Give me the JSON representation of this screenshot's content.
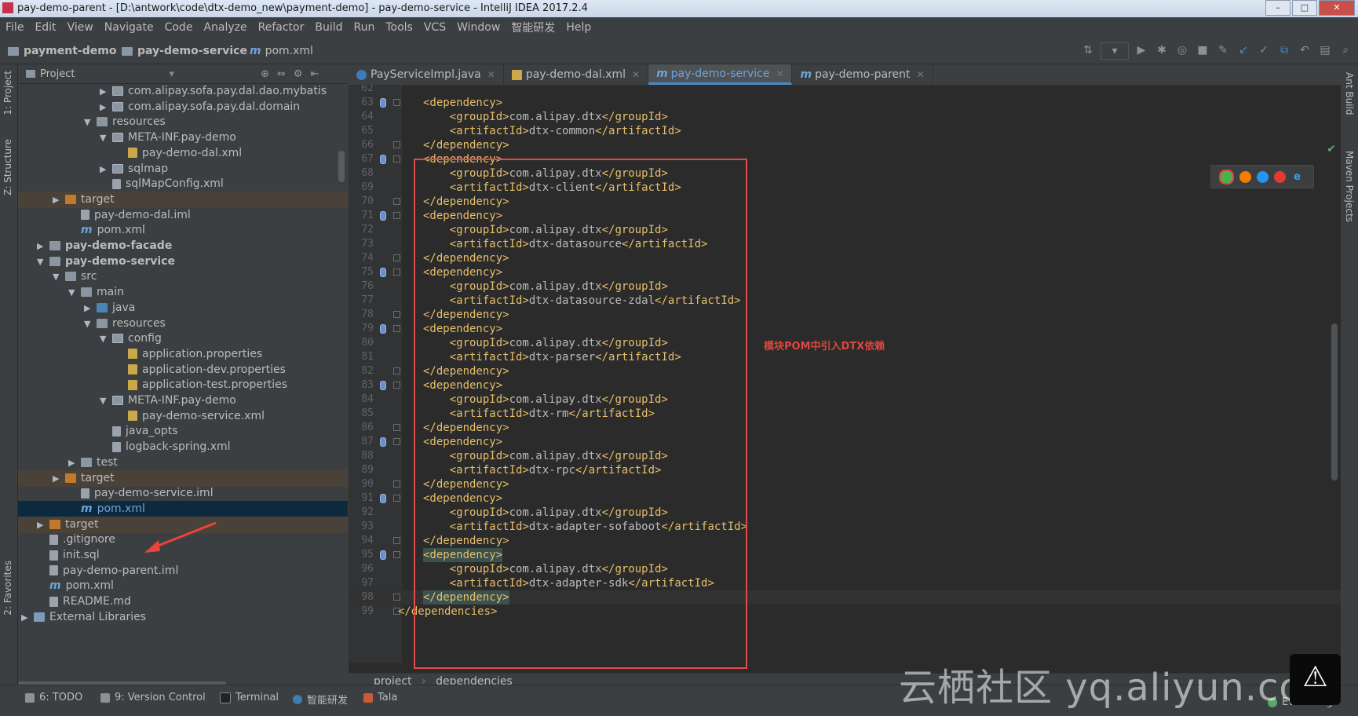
{
  "window": {
    "title": "pay-demo-parent - [D:\\antwork\\code\\dtx-demo_new\\payment-demo] - pay-demo-service - IntelliJ IDEA 2017.2.4"
  },
  "menu": [
    "File",
    "Edit",
    "View",
    "Navigate",
    "Code",
    "Analyze",
    "Refactor",
    "Build",
    "Run",
    "Tools",
    "VCS",
    "Window",
    "智能研发",
    "Help"
  ],
  "breadcrumbs": {
    "root": "payment-demo",
    "module": "pay-demo-service",
    "file": "pom.xml"
  },
  "left_tools": {
    "project": "1: Project",
    "structure": "Z: Structure",
    "favorites": "2: Favorites"
  },
  "right_tools": {
    "ant": "Ant Build",
    "maven": "Maven Projects"
  },
  "project_panel": {
    "header": "Project",
    "tree": [
      {
        "label": "com.alipay.sofa.pay.dal.dao.mybatis",
        "icon": "package-icon",
        "arrow": "▶"
      },
      {
        "label": "com.alipay.sofa.pay.dal.domain",
        "icon": "package-icon",
        "arrow": "▶"
      },
      {
        "label": "resources",
        "icon": "folder-icon",
        "arrow": "▼"
      },
      {
        "label": "META-INF.pay-demo",
        "icon": "package-icon",
        "arrow": "▼"
      },
      {
        "label": "pay-demo-dal.xml",
        "icon": "xml-file-icon",
        "arrow": ""
      },
      {
        "label": "sqlmap",
        "icon": "package-icon",
        "arrow": "▶"
      },
      {
        "label": "sqlMapConfig.xml",
        "icon": "file-icon",
        "arrow": ""
      },
      {
        "label": "target",
        "icon": "folder-orange-icon",
        "arrow": "▶"
      },
      {
        "label": "pay-demo-dal.iml",
        "icon": "file-icon",
        "arrow": ""
      },
      {
        "label": "pom.xml",
        "icon": "maven-icon",
        "arrow": ""
      },
      {
        "label": "pay-demo-facade",
        "icon": "module-icon",
        "arrow": "▶"
      },
      {
        "label": "pay-demo-service",
        "icon": "module-icon",
        "arrow": "▼"
      },
      {
        "label": "src",
        "icon": "folder-icon",
        "arrow": "▼"
      },
      {
        "label": "main",
        "icon": "folder-icon",
        "arrow": "▼"
      },
      {
        "label": "java",
        "icon": "source-folder-icon",
        "arrow": "▶"
      },
      {
        "label": "resources",
        "icon": "folder-icon",
        "arrow": "▼"
      },
      {
        "label": "config",
        "icon": "package-icon",
        "arrow": "▼"
      },
      {
        "label": "application.properties",
        "icon": "properties-file-icon",
        "arrow": ""
      },
      {
        "label": "application-dev.properties",
        "icon": "properties-file-icon",
        "arrow": ""
      },
      {
        "label": "application-test.properties",
        "icon": "properties-file-icon",
        "arrow": ""
      },
      {
        "label": "META-INF.pay-demo",
        "icon": "package-icon",
        "arrow": "▼"
      },
      {
        "label": "pay-demo-service.xml",
        "icon": "xml-file-icon",
        "arrow": ""
      },
      {
        "label": "java_opts",
        "icon": "file-icon",
        "arrow": ""
      },
      {
        "label": "logback-spring.xml",
        "icon": "file-icon",
        "arrow": ""
      },
      {
        "label": "test",
        "icon": "folder-icon",
        "arrow": "▶"
      },
      {
        "label": "target",
        "icon": "folder-orange-icon",
        "arrow": "▶"
      },
      {
        "label": "pay-demo-service.iml",
        "icon": "file-icon",
        "arrow": ""
      },
      {
        "label": "pom.xml",
        "icon": "maven-icon",
        "arrow": ""
      },
      {
        "label": "target",
        "icon": "folder-orange-icon",
        "arrow": "▶"
      },
      {
        "label": ".gitignore",
        "icon": "file-icon",
        "arrow": ""
      },
      {
        "label": "init.sql",
        "icon": "file-icon",
        "arrow": ""
      },
      {
        "label": "pay-demo-parent.iml",
        "icon": "file-icon",
        "arrow": ""
      },
      {
        "label": "pom.xml",
        "icon": "maven-icon",
        "arrow": ""
      },
      {
        "label": "README.md",
        "icon": "file-icon",
        "arrow": ""
      },
      {
        "label": "External Libraries",
        "icon": "libraries-icon",
        "arrow": "▶"
      }
    ]
  },
  "editor": {
    "tabs": [
      {
        "label": "PayServiceImpl.java",
        "active": false
      },
      {
        "label": "pay-demo-dal.xml",
        "active": false
      },
      {
        "label": "pay-demo-service",
        "active": true
      },
      {
        "label": "pay-demo-parent",
        "active": false
      }
    ],
    "lines": [
      {
        "n": "62",
        "text": ""
      },
      {
        "n": "63",
        "text": "<dependency>"
      },
      {
        "n": "64",
        "text": "    <groupId>com.alipay.dtx</groupId>"
      },
      {
        "n": "65",
        "text": "    <artifactId>dtx-common</artifactId>"
      },
      {
        "n": "66",
        "text": "</dependency>"
      },
      {
        "n": "67",
        "text": "<dependency>"
      },
      {
        "n": "68",
        "text": "    <groupId>com.alipay.dtx</groupId>"
      },
      {
        "n": "69",
        "text": "    <artifactId>dtx-client</artifactId>"
      },
      {
        "n": "70",
        "text": "</dependency>"
      },
      {
        "n": "71",
        "text": "<dependency>"
      },
      {
        "n": "72",
        "text": "    <groupId>com.alipay.dtx</groupId>"
      },
      {
        "n": "73",
        "text": "    <artifactId>dtx-datasource</artifactId>"
      },
      {
        "n": "74",
        "text": "</dependency>"
      },
      {
        "n": "75",
        "text": "<dependency>"
      },
      {
        "n": "76",
        "text": "    <groupId>com.alipay.dtx</groupId>"
      },
      {
        "n": "77",
        "text": "    <artifactId>dtx-datasource-zdal</artifactId>"
      },
      {
        "n": "78",
        "text": "</dependency>"
      },
      {
        "n": "79",
        "text": "<dependency>"
      },
      {
        "n": "80",
        "text": "    <groupId>com.alipay.dtx</groupId>"
      },
      {
        "n": "81",
        "text": "    <artifactId>dtx-parser</artifactId>"
      },
      {
        "n": "82",
        "text": "</dependency>"
      },
      {
        "n": "83",
        "text": "<dependency>"
      },
      {
        "n": "84",
        "text": "    <groupId>com.alipay.dtx</groupId>"
      },
      {
        "n": "85",
        "text": "    <artifactId>dtx-rm</artifactId>"
      },
      {
        "n": "86",
        "text": "</dependency>"
      },
      {
        "n": "87",
        "text": "<dependency>"
      },
      {
        "n": "88",
        "text": "    <groupId>com.alipay.dtx</groupId>"
      },
      {
        "n": "89",
        "text": "    <artifactId>dtx-rpc</artifactId>"
      },
      {
        "n": "90",
        "text": "</dependency>"
      },
      {
        "n": "91",
        "text": "<dependency>"
      },
      {
        "n": "92",
        "text": "    <groupId>com.alipay.dtx</groupId>"
      },
      {
        "n": "93",
        "text": "    <artifactId>dtx-adapter-sofaboot</artifactId>"
      },
      {
        "n": "94",
        "text": "</dependency>"
      },
      {
        "n": "95",
        "text": "<dependency>"
      },
      {
        "n": "96",
        "text": "    <groupId>com.alipay.dtx</groupId>"
      },
      {
        "n": "97",
        "text": "    <artifactId>dtx-adapter-sdk</artifactId>"
      },
      {
        "n": "98",
        "text": "</dependency>"
      },
      {
        "n": "99",
        "text": "</dependencies>"
      }
    ],
    "annotation": "模块POM中引入DTX依赖",
    "breadcrumb": [
      "project",
      "dependencies"
    ]
  },
  "statusbar": {
    "todo": "6: TODO",
    "vcs": "9: Version Control",
    "terminal": "Terminal",
    "smart": "智能研发",
    "tala": "Tala",
    "eventlog": "Event Log"
  },
  "watermark": "云栖社区 yq.aliyun.com",
  "colors": {
    "tag": "#e8bf6a",
    "text": "#a9b7c6",
    "annotation": "#e0463b",
    "redbox": "#e04a4a",
    "selection": "#0d293e"
  }
}
